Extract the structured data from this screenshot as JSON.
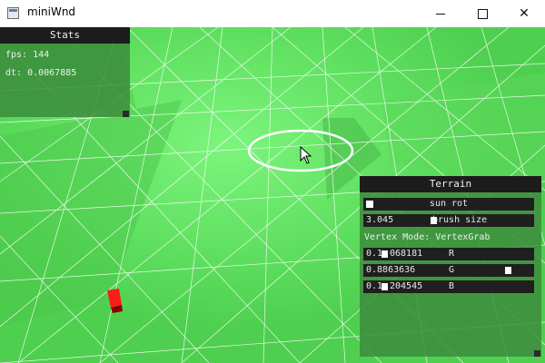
{
  "window": {
    "title": "miniWnd",
    "minimize_label": "minimize",
    "maximize_label": "maximize",
    "close_label": "close",
    "close_glyph": "✕"
  },
  "stats_panel": {
    "title": "Stats",
    "fps_line": "fps: 144",
    "dt_line": "dt: 0.0067885"
  },
  "terrain_panel": {
    "title": "Terrain",
    "sun_rot_label": "sun rot",
    "brush_size": {
      "value": "3.045",
      "label": "brush size",
      "position": 0.41
    },
    "vertex_mode_line": "Vertex Mode: VertexGrab",
    "color_r": {
      "value": "0.1",
      "value_tail": "068181",
      "label": "R",
      "position": 0.1
    },
    "color_g": {
      "value": "0.8863636",
      "label": "G",
      "position": 0.88
    },
    "color_b": {
      "value": "0.1",
      "value_tail": "204545",
      "label": "B",
      "position": 0.1
    }
  },
  "colors": {
    "ground": "#55d955",
    "grid": "#ffffff",
    "panel_bg": "#3c8c3c",
    "title_bar": "#1c1c1c",
    "marker": "#ff0000"
  },
  "icons": {
    "cursor": "arrow-cursor-icon",
    "brush": "brush-circle-icon"
  }
}
